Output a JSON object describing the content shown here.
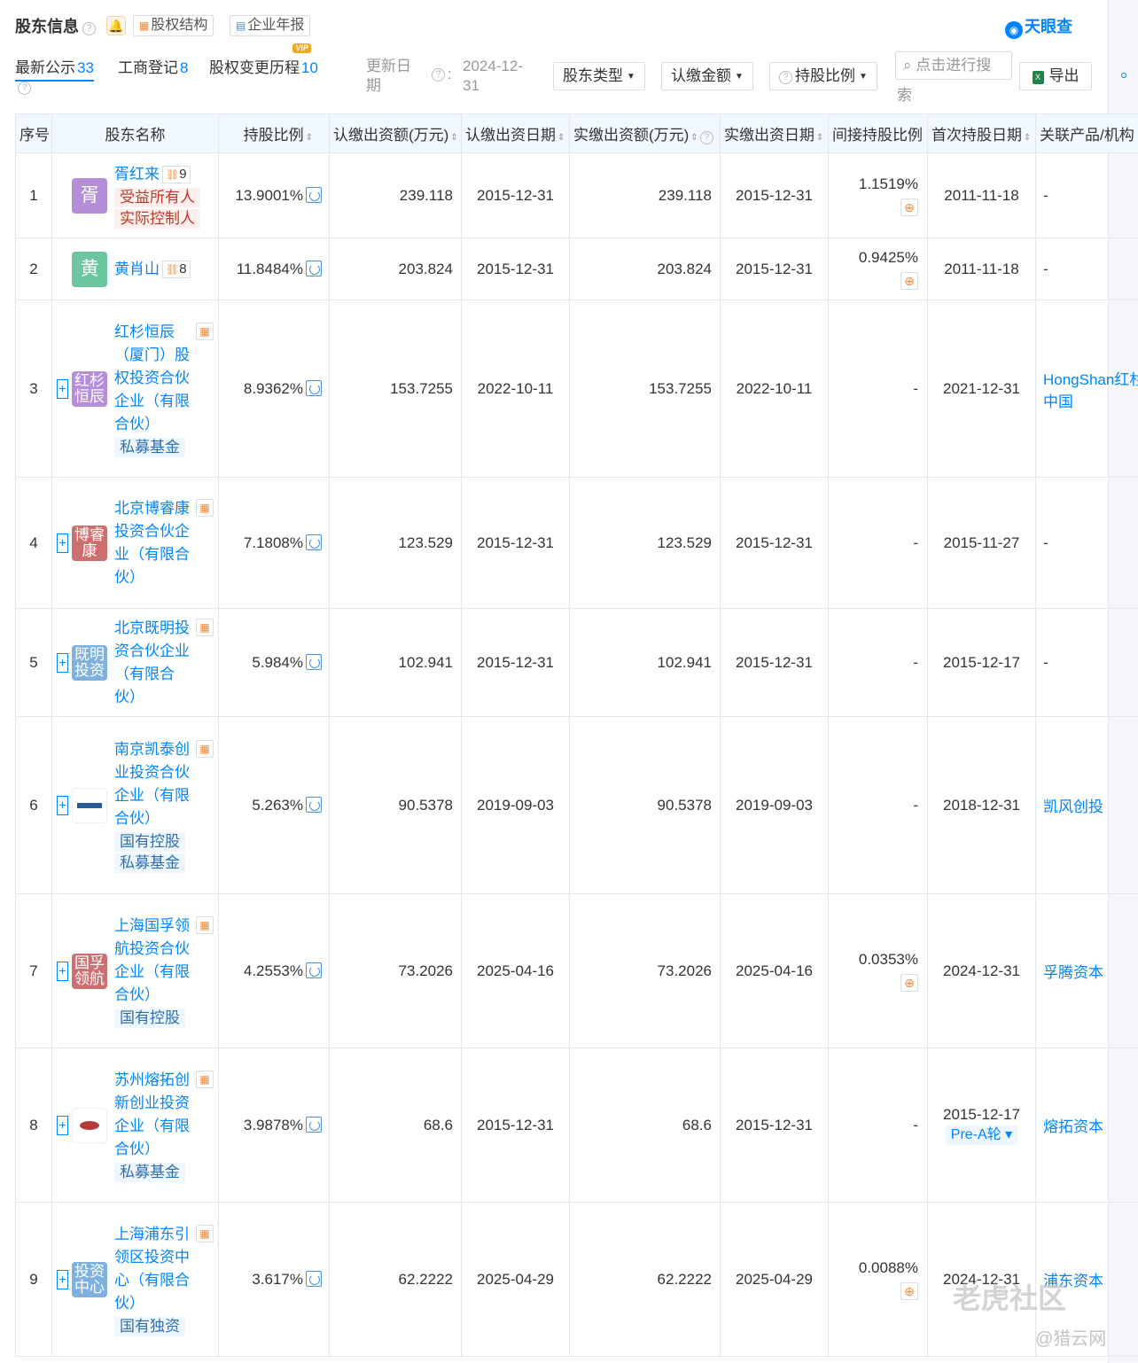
{
  "header": {
    "title": "股东信息",
    "pill_structure": "股权结构",
    "pill_report": "企业年报",
    "logo": "天眼查"
  },
  "tabs": [
    {
      "label": "最新公示",
      "count": "33"
    },
    {
      "label": "工商登记",
      "count": "8"
    },
    {
      "label": "股权变更历程",
      "count": "10",
      "badge": "VIP"
    }
  ],
  "update": {
    "label": "更新日期",
    "colon": ":",
    "value": "2024-12-31"
  },
  "filters": {
    "type": "股东类型",
    "amount": "认缴金额",
    "ratio": "持股比例",
    "search_placeholder": "点击进行搜",
    "search_wrap": "索",
    "export": "导出"
  },
  "columns": [
    "序号",
    "股东名称",
    "持股比例",
    "认缴出资额(万元)",
    "认缴出资日期",
    "实缴出资额(万元)",
    "实缴出资日期",
    "间接持股比例",
    "首次持股日期",
    "关联产品/机构"
  ],
  "rows": [
    {
      "idx": "1",
      "avatar": "胥",
      "avatar_color": "#b48ed8",
      "name": "胥红来",
      "rel_count": "9",
      "tags": [
        {
          "t": "受益所有人",
          "c": "red"
        },
        {
          "t": "实际控制人",
          "c": "red"
        }
      ],
      "pct": "13.9001%",
      "sub_amt": "239.118",
      "sub_date": "2015-12-31",
      "paid_amt": "239.118",
      "paid_date": "2015-12-31",
      "indirect": "1.1519%",
      "first": "2011-11-18",
      "related": "-"
    },
    {
      "idx": "2",
      "avatar": "黄",
      "avatar_color": "#6cc6a0",
      "name": "黄肖山",
      "rel_count": "8",
      "tags": [],
      "pct": "11.8484%",
      "sub_amt": "203.824",
      "sub_date": "2015-12-31",
      "paid_amt": "203.824",
      "paid_date": "2015-12-31",
      "indirect": "0.9425%",
      "first": "2011-11-18",
      "related": "-"
    },
    {
      "idx": "3",
      "avatar": "红杉恒辰",
      "avatar_color": "#b48ed8",
      "name": "红杉恒辰（厦门）股权投资合伙企业（有限合伙）",
      "tags": [
        {
          "t": "私募基金",
          "c": "blue"
        }
      ],
      "pct": "8.9362%",
      "sub_amt": "153.7255",
      "sub_date": "2022-10-11",
      "paid_amt": "153.7255",
      "paid_date": "2022-10-11",
      "indirect": "-",
      "first": "2021-12-31",
      "related": "HongShan红杉中国"
    },
    {
      "idx": "4",
      "avatar": "博睿康",
      "avatar_color": "#cc6f6f",
      "name": "北京博睿康投资合伙企业（有限合伙）",
      "tags": [],
      "pct": "7.1808%",
      "sub_amt": "123.529",
      "sub_date": "2015-12-31",
      "paid_amt": "123.529",
      "paid_date": "2015-12-31",
      "indirect": "-",
      "first": "2015-11-27",
      "related": "-"
    },
    {
      "idx": "5",
      "avatar": "既明投资",
      "avatar_color": "#7eb1e0",
      "name": "北京既明投资合伙企业（有限合伙）",
      "tags": [],
      "pct": "5.984%",
      "sub_amt": "102.941",
      "sub_date": "2015-12-31",
      "paid_amt": "102.941",
      "paid_date": "2015-12-31",
      "indirect": "-",
      "first": "2015-12-17",
      "related": "-"
    },
    {
      "idx": "6",
      "avatar": "",
      "avatar_color": "",
      "name": "南京凯泰创业投资合伙企业（有限合伙）",
      "tags": [
        {
          "t": "国有控股",
          "c": "blue"
        },
        {
          "t": "私募基金",
          "c": "blue"
        }
      ],
      "pct": "5.263%",
      "sub_amt": "90.5378",
      "sub_date": "2019-09-03",
      "paid_amt": "90.5378",
      "paid_date": "2019-09-03",
      "indirect": "-",
      "first": "2018-12-31",
      "related": "凯风创投"
    },
    {
      "idx": "7",
      "avatar": "国孚领航",
      "avatar_color": "#cc6f6f",
      "name": "上海国孚领航投资合伙企业（有限合伙）",
      "tags": [
        {
          "t": "国有控股",
          "c": "blue"
        }
      ],
      "pct": "4.2553%",
      "sub_amt": "73.2026",
      "sub_date": "2025-04-16",
      "paid_amt": "73.2026",
      "paid_date": "2025-04-16",
      "indirect": "0.0353%",
      "first": "2024-12-31",
      "related": "孚腾资本"
    },
    {
      "idx": "8",
      "avatar": "",
      "avatar_color": "",
      "name": "苏州熔拓创新创业投资企业（有限合伙）",
      "tags": [
        {
          "t": "私募基金",
          "c": "blue"
        }
      ],
      "pct": "3.9878%",
      "sub_amt": "68.6",
      "sub_date": "2015-12-31",
      "paid_amt": "68.6",
      "paid_date": "2015-12-31",
      "indirect": "-",
      "first": "2015-12-17",
      "round": "Pre-A轮",
      "related": "熔拓资本"
    },
    {
      "idx": "9",
      "avatar": "投资中心",
      "avatar_color": "#7eb1e0",
      "name": "上海浦东引领区投资中心（有限合伙）",
      "tags": [
        {
          "t": "国有独资",
          "c": "blue"
        }
      ],
      "pct": "3.617%",
      "sub_amt": "62.2222",
      "sub_date": "2025-04-29",
      "paid_amt": "62.2222",
      "paid_date": "2025-04-29",
      "indirect": "0.0088%",
      "first": "2024-12-31",
      "related": "浦东资本"
    }
  ],
  "watermark": {
    "main": "老虎社区",
    "sub": "@猎云网"
  }
}
